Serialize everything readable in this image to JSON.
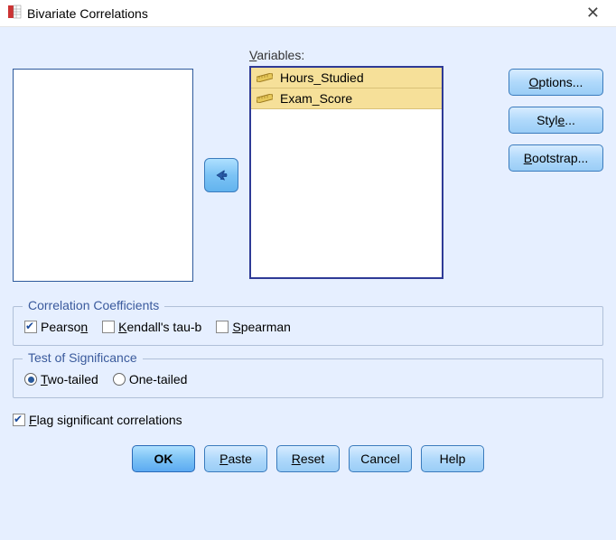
{
  "title": "Bivariate Correlations",
  "variables_label_pre": "V",
  "variables_label_rest": "ariables:",
  "variables": [
    {
      "name": "Hours_Studied"
    },
    {
      "name": "Exam_Score"
    }
  ],
  "side_buttons": {
    "options_pre": "O",
    "options_rest": "ptions...",
    "style_pre": "Styl",
    "style_mid": "e",
    "style_rest": "...",
    "bootstrap_pre": "B",
    "bootstrap_rest": "ootstrap..."
  },
  "groups": {
    "corr_title": "Correlation Coefficients",
    "pearson_pre": "Pearso",
    "pearson_u": "n",
    "kendall_pre": "K",
    "kendall_rest": "endall's tau-b",
    "spearman_pre": "S",
    "spearman_rest": "pearman",
    "test_title": "Test of Significance",
    "two_pre": "T",
    "two_rest": "wo-tailed",
    "one_label": "One-tailed"
  },
  "flag_pre": "F",
  "flag_rest": "lag significant correlations",
  "buttons": {
    "ok": "OK",
    "paste_pre": "P",
    "paste_rest": "aste",
    "reset_pre": "R",
    "reset_rest": "eset",
    "cancel": "Cancel",
    "help": "Help"
  },
  "states": {
    "pearson": true,
    "kendall": false,
    "spearman": false,
    "two_tailed": true,
    "flag": true
  }
}
